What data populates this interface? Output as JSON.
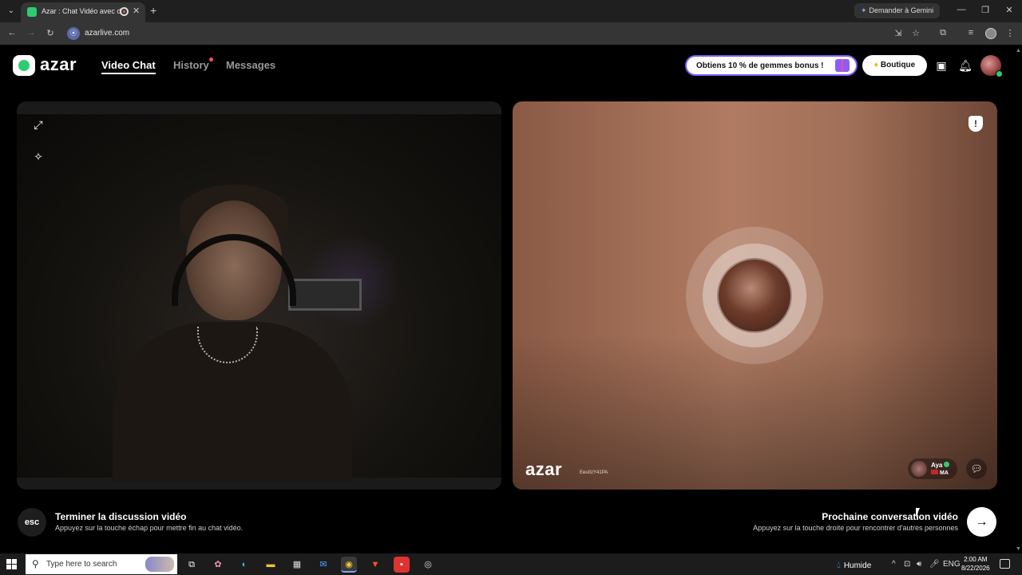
{
  "browser": {
    "tab_title": "Azar : Chat Vidéo avec de",
    "tab_close": "✕",
    "new_tab": "+",
    "gemini_label": "Demander à Gemini",
    "url": "azarlive.com"
  },
  "header": {
    "logo": "azar",
    "nav": [
      {
        "label": "Video Chat",
        "active": true
      },
      {
        "label": "History",
        "active": false
      },
      {
        "label": "Messages",
        "active": false
      }
    ],
    "promo": "Obtiens 10 % de gemmes bonus !",
    "boutique": "Boutique"
  },
  "peer": {
    "watermark": "azar",
    "session_id": "Eeu0zY41PA",
    "name": "Aya",
    "country": "MA"
  },
  "footer": {
    "esc_key": "esc",
    "end_title": "Terminer la discussion vidéo",
    "end_sub": "Appuyez sur la touche échap pour mettre fin au chat vidéo.",
    "next_title": "Prochaine conversation vidéo",
    "next_sub": "Appuyez sur la touche droite pour rencontrer d'autres personnes"
  },
  "taskbar": {
    "search_placeholder": "Type here to search",
    "weather": "Humide",
    "lang": "ENG",
    "time": "2:00 AM",
    "date": "8/22/2026"
  },
  "colors": {
    "accent_green": "#2ecc71",
    "promo_border": "#7b5cff",
    "history_dot": "#ff4d6d"
  }
}
